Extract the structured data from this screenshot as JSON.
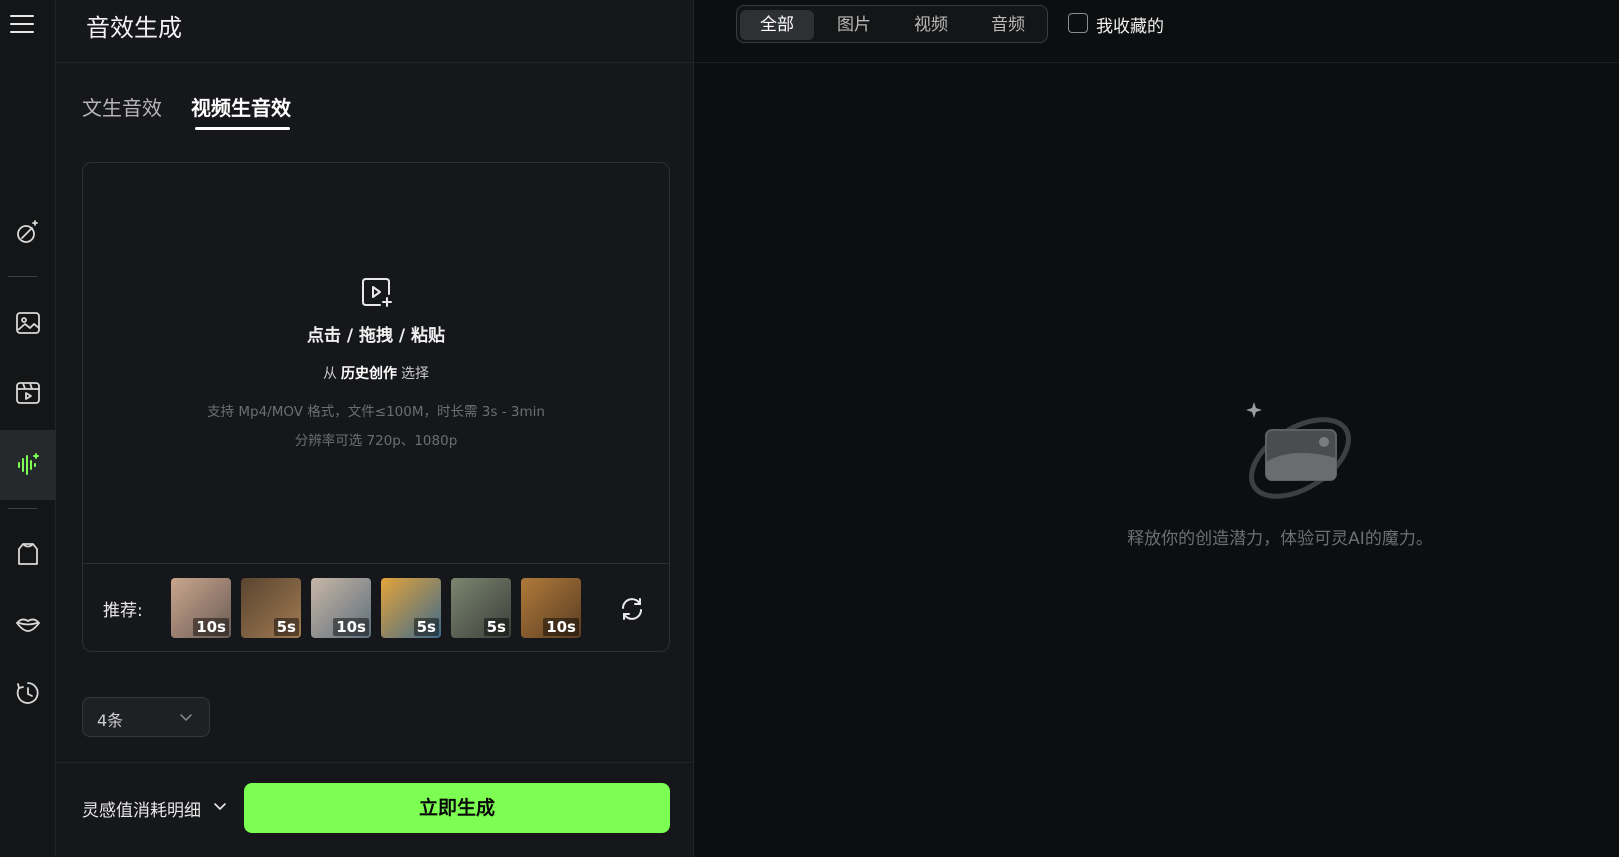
{
  "page": {
    "title": "音效生成"
  },
  "tabs": [
    {
      "label": "文生音效",
      "active": false
    },
    {
      "label": "视频生音效",
      "active": true
    }
  ],
  "upload": {
    "main": "点击 / 拖拽 / 粘贴",
    "sub_prefix": "从",
    "sub_link": "历史创作",
    "sub_suffix": "选择",
    "hint1": "支持 Mp4/MOV 格式，文件≤100M，时长需 3s - 3min",
    "hint2": "分辨率可选 720p、1080p"
  },
  "recommend": {
    "label": "推荐:",
    "items": [
      {
        "duration": "10s",
        "colors": [
          "#c9a68d",
          "#6b5a55"
        ]
      },
      {
        "duration": "5s",
        "colors": [
          "#5a4530",
          "#a07a52"
        ]
      },
      {
        "duration": "10s",
        "colors": [
          "#c7b7a6",
          "#5d6e7c"
        ]
      },
      {
        "duration": "5s",
        "colors": [
          "#e4a43a",
          "#3e6a8b"
        ]
      },
      {
        "duration": "5s",
        "colors": [
          "#7c8670",
          "#3b3f3a"
        ]
      },
      {
        "duration": "10s",
        "colors": [
          "#b07a3a",
          "#5a3d22"
        ]
      }
    ]
  },
  "count_select": {
    "value": "4条"
  },
  "footer": {
    "cost_label": "灵感值消耗明细",
    "generate_label": "立即生成"
  },
  "filters": [
    {
      "label": "全部",
      "active": true
    },
    {
      "label": "图片",
      "active": false
    },
    {
      "label": "视频",
      "active": false
    },
    {
      "label": "音频",
      "active": false
    }
  ],
  "favorites": {
    "label": "我收藏的"
  },
  "empty_state": {
    "text": "释放你的创造潜力，体验可灵AI的魔力。"
  },
  "colors": {
    "accent": "#7cff52",
    "active_rail_icon": "#7cff52"
  }
}
